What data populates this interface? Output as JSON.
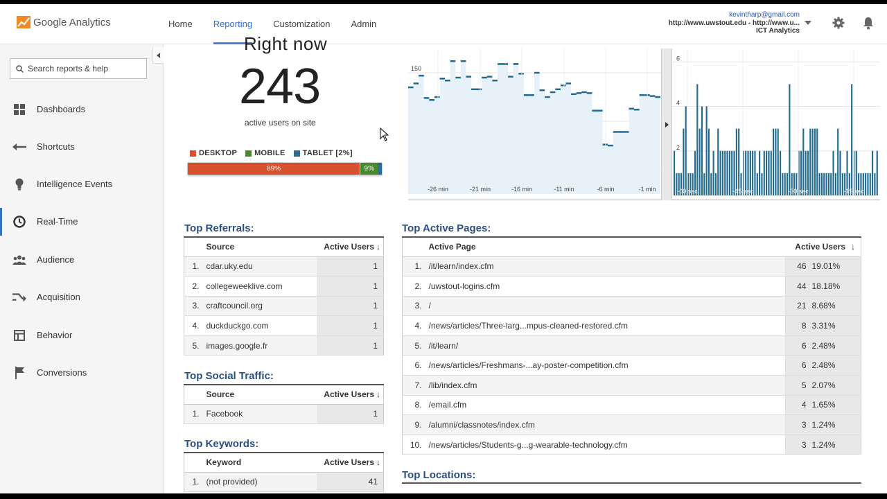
{
  "topbar": {
    "logo_text": "Google Analytics",
    "nav": [
      "Home",
      "Reporting",
      "Customization",
      "Admin"
    ],
    "active_nav": "Reporting",
    "account_email": "kevintharp@gmail.com",
    "account_property": "http://www.uwstout.edu - http://www.u...",
    "account_view": "ICT Analytics"
  },
  "sidebar": {
    "search_placeholder": "Search reports & help",
    "items": [
      {
        "label": "Dashboards",
        "icon": "dashboard-icon"
      },
      {
        "label": "Shortcuts",
        "icon": "shortcut-arrow-icon"
      },
      {
        "label": "Intelligence Events",
        "icon": "lightbulb-icon"
      },
      {
        "label": "Real-Time",
        "icon": "clock-icon",
        "active": true
      },
      {
        "label": "Audience",
        "icon": "people-icon"
      },
      {
        "label": "Acquisition",
        "icon": "acquisition-arrows-icon"
      },
      {
        "label": "Behavior",
        "icon": "behavior-layout-icon"
      },
      {
        "label": "Conversions",
        "icon": "flag-icon"
      }
    ]
  },
  "overview": {
    "title_fragment": "Right now",
    "active_users": "243",
    "active_users_label": "active users on site",
    "legend": [
      {
        "label": "DESKTOP",
        "color": "#d9502e"
      },
      {
        "label": "MOBILE",
        "color": "#4a8a2e"
      },
      {
        "label": "TABLET [2%]",
        "color": "#2b6e94"
      }
    ],
    "device_split": [
      {
        "label": "89%",
        "value": 0.89,
        "color": "#d9502e"
      },
      {
        "label": "9%",
        "value": 0.09,
        "color": "#4a8a2e"
      },
      {
        "label": "",
        "value": 0.02,
        "color": "#2b6e94"
      }
    ]
  },
  "chart_data": [
    {
      "type": "line",
      "title": "",
      "x_ticks": [
        "-26 min",
        "-21 min",
        "-16 min",
        "-11 min",
        "-6 min",
        "-1 min"
      ],
      "y_ticks": [
        50,
        100,
        150
      ],
      "ylim": [
        25,
        175
      ],
      "values": [
        135,
        139,
        147,
        124,
        122,
        125,
        144,
        142,
        162,
        145,
        162,
        146,
        133,
        133,
        145,
        146,
        142,
        159,
        159,
        146,
        159,
        149,
        127,
        127,
        150,
        132,
        125,
        130,
        133,
        137,
        139,
        128,
        129,
        130,
        129,
        111,
        111,
        76,
        75,
        89,
        89,
        89,
        113,
        112,
        127,
        127,
        126,
        125
      ],
      "grid": true
    },
    {
      "type": "bar",
      "title": "",
      "x_ticks": [
        "-60 sec",
        "-45 sec",
        "-30 sec",
        "-15 sec"
      ],
      "y_ticks": [
        2,
        4,
        6
      ],
      "ylim": [
        0,
        6.6
      ],
      "values": [
        2,
        1,
        1,
        1,
        3,
        4,
        1,
        1,
        1,
        2,
        5,
        3,
        4,
        1,
        4,
        3,
        1,
        2,
        1,
        3,
        2,
        2,
        2,
        2,
        2,
        2,
        2,
        3,
        3,
        1,
        2,
        2,
        2,
        2,
        2,
        2,
        1,
        2,
        1,
        2,
        2,
        2,
        2,
        3,
        3,
        3,
        2,
        1,
        1,
        1,
        5,
        1,
        1,
        1,
        2,
        2,
        3,
        2,
        2,
        3,
        3,
        3,
        3,
        1,
        1,
        1,
        1,
        1,
        1,
        2,
        1,
        3,
        2,
        1,
        1,
        2,
        1,
        5,
        2,
        2,
        1,
        1,
        1,
        1,
        1,
        1,
        2,
        1,
        2
      ],
      "bar_color": "#1f6a8f",
      "grid": true
    }
  ],
  "referrals": {
    "title": "Top Referrals:",
    "col_source": "Source",
    "col_users": "Active Users",
    "rows": [
      {
        "idx": "1.",
        "source": "cdar.uky.edu",
        "users": "1"
      },
      {
        "idx": "2.",
        "source": "collegeweeklive.com",
        "users": "1"
      },
      {
        "idx": "3.",
        "source": "craftcouncil.org",
        "users": "1"
      },
      {
        "idx": "4.",
        "source": "duckduckgo.com",
        "users": "1"
      },
      {
        "idx": "5.",
        "source": "images.google.fr",
        "users": "1"
      }
    ]
  },
  "social": {
    "title": "Top Social Traffic:",
    "col_source": "Source",
    "col_users": "Active Users",
    "rows": [
      {
        "idx": "1.",
        "source": "Facebook",
        "users": "1"
      }
    ]
  },
  "keywords": {
    "title": "Top Keywords:",
    "col_keyword": "Keyword",
    "col_users": "Active Users",
    "rows": [
      {
        "idx": "1.",
        "keyword": "(not provided)",
        "users": "41"
      }
    ]
  },
  "pages": {
    "title": "Top Active Pages:",
    "col_page": "Active Page",
    "col_users": "Active Users",
    "rows": [
      {
        "idx": "1.",
        "page": "/it/learn/index.cfm",
        "users": "46",
        "pct": "19.01%"
      },
      {
        "idx": "2.",
        "page": "/uwstout-logins.cfm",
        "users": "44",
        "pct": "18.18%"
      },
      {
        "idx": "3.",
        "page": "/",
        "users": "21",
        "pct": "8.68%"
      },
      {
        "idx": "4.",
        "page": "/news/articles/Three-larg...mpus-cleaned-restored.cfm",
        "users": "8",
        "pct": "3.31%"
      },
      {
        "idx": "5.",
        "page": "/it/learn/",
        "users": "6",
        "pct": "2.48%"
      },
      {
        "idx": "6.",
        "page": "/news/articles/Freshmans-...ay-poster-competition.cfm",
        "users": "6",
        "pct": "2.48%"
      },
      {
        "idx": "7.",
        "page": "/lib/index.cfm",
        "users": "5",
        "pct": "2.07%"
      },
      {
        "idx": "8.",
        "page": "/email.cfm",
        "users": "4",
        "pct": "1.65%"
      },
      {
        "idx": "9.",
        "page": "/alumni/classnotes/index.cfm",
        "users": "3",
        "pct": "1.24%"
      },
      {
        "idx": "10.",
        "page": "/news/articles/Students-g...g-wearable-technology.cfm",
        "users": "3",
        "pct": "1.24%"
      }
    ]
  },
  "locations": {
    "title": "Top Locations:"
  }
}
